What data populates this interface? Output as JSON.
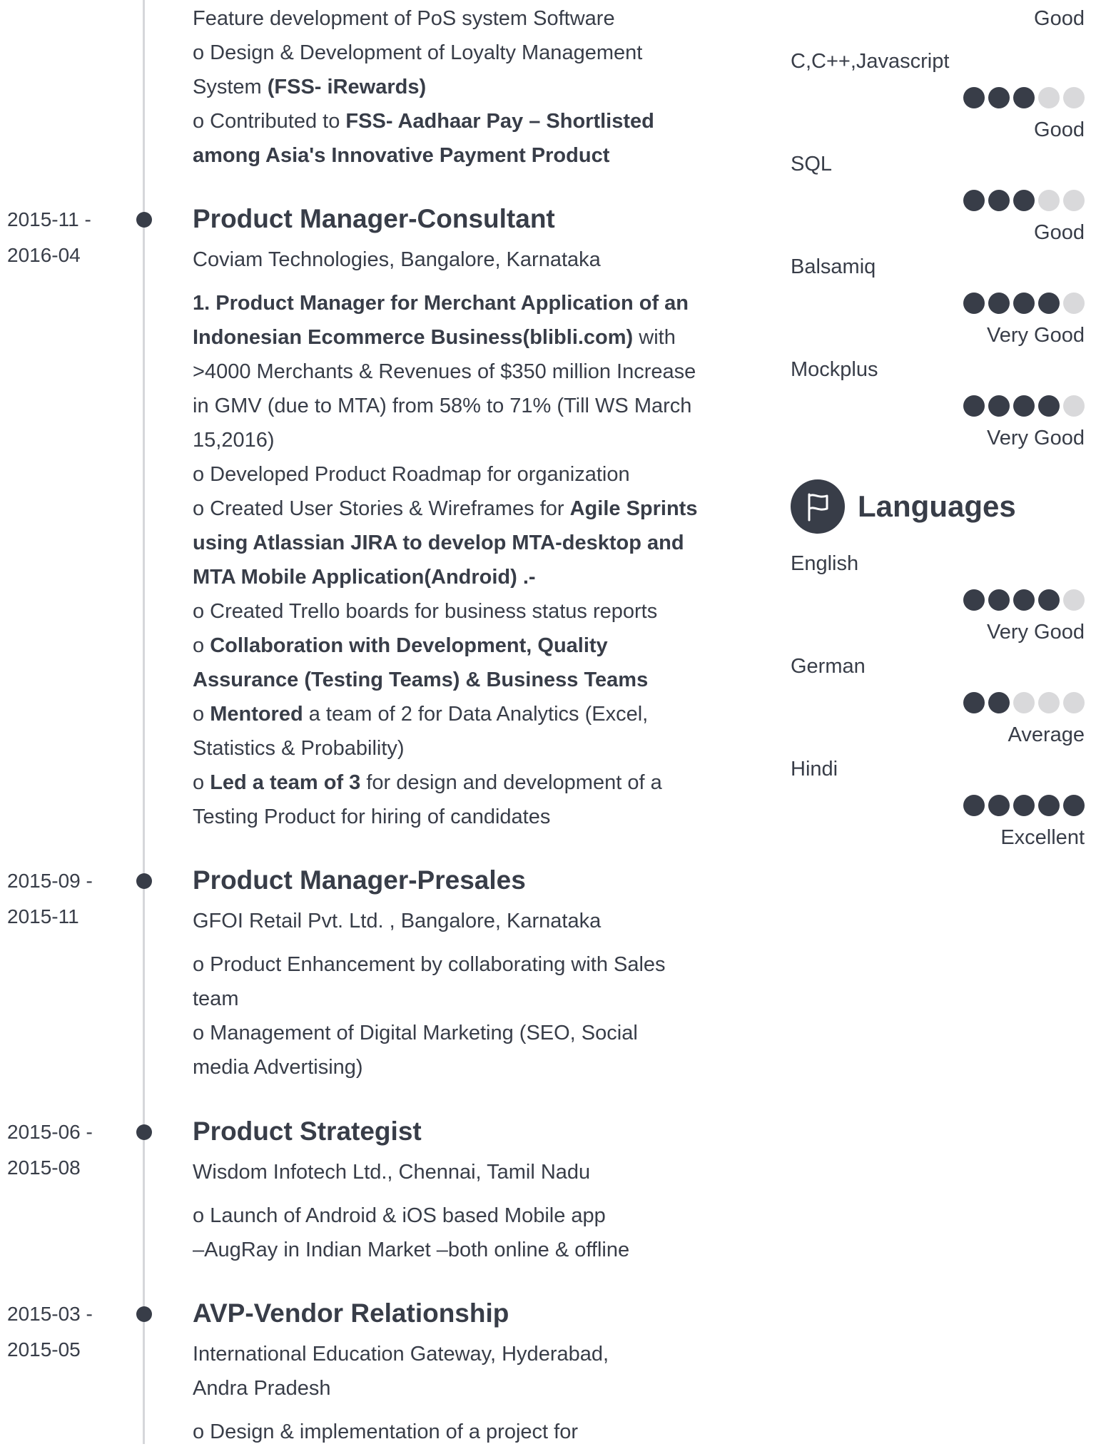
{
  "colors": {
    "text": "#383d48",
    "dot_filled": "#383d48",
    "dot_empty": "#d9d9db",
    "timeline": "#d6d7da"
  },
  "experience": {
    "intro": {
      "line1": "Feature development of PoS system Software",
      "line2": "o Design & Development of Loyalty Management",
      "line3_a": "System ",
      "line3_b": "(FSS- iRewards)",
      "line4_a": "o Contributed to ",
      "line4_b": "FSS- Aadhaar Pay – Shortlisted",
      "line5_b": "among Asia's Innovative Payment Product"
    },
    "entries": [
      {
        "date_start": "2015-11 -",
        "date_end": "2016-04",
        "title": "Product Manager-Consultant",
        "company": "Coviam Technologies, Bangalore, Karnataka",
        "d1_b": "1. Product Manager for Merchant Application of an",
        "d2_b": "Indonesian Ecommerce Business(blibli.com)",
        "d2_a": " with",
        "d3": ">4000 Merchants & Revenues of $350 million Increase",
        "d4": "in GMV (due to MTA) from 58% to 71% (Till WS March",
        "d5": "15,2016)",
        "d6": "o Developed Product Roadmap for organization",
        "d7_a": "o Created User Stories & Wireframes for ",
        "d7_b": "Agile Sprints",
        "d8_b": "using Atlassian JIRA to develop MTA-desktop and",
        "d9_b": "MTA Mobile Application(Android) .-",
        "d10": "o Created Trello boards for business status reports",
        "d11_a": "o ",
        "d11_b": "Collaboration with Development, Quality",
        "d12_b": "Assurance (Testing Teams) & Business Teams",
        "d13_a": "o ",
        "d13_b": "Mentored",
        "d13_c": " a team of 2 for Data Analytics (Excel,",
        "d14": "Statistics & Probability)",
        "d15_a": "o ",
        "d15_b": "Led a team of 3",
        "d15_c": " for design and development of a",
        "d16": "Testing Product for hiring of candidates"
      },
      {
        "date_start": "2015-09 -",
        "date_end": "2015-11",
        "title": "Product Manager-Presales",
        "company": "GFOI Retail Pvt. Ltd. , Bangalore, Karnataka",
        "d1": "o Product Enhancement by collaborating with Sales",
        "d2": "team",
        "d3": "o Management of Digital Marketing (SEO, Social",
        "d4": "media Advertising)"
      },
      {
        "date_start": "2015-06 -",
        "date_end": "2015-08",
        "title": "Product Strategist",
        "company": "Wisdom Infotech Ltd., Chennai, Tamil Nadu",
        "d1": "o Launch of Android & iOS based Mobile app",
        "d2": "–AugRay in Indian Market –both online & offline"
      },
      {
        "date_start": "2015-03 -",
        "date_end": "2015-05",
        "title": "AVP-Vendor Relationship",
        "company_l1": "International Education Gateway, Hyderabad,",
        "company_l2": "Andra Pradesh",
        "d1": "o Design & implementation of a project for"
      }
    ]
  },
  "skills": {
    "top_level": "Good",
    "items": [
      {
        "name": "C,C++,Javascript",
        "rating": 3,
        "max": 5,
        "level": "Good"
      },
      {
        "name": "SQL",
        "rating": 3,
        "max": 5,
        "level": "Good"
      },
      {
        "name": "Balsamiq",
        "rating": 4,
        "max": 5,
        "level": "Very Good"
      },
      {
        "name": "Mockplus",
        "rating": 4,
        "max": 5,
        "level": "Very Good"
      }
    ]
  },
  "languages": {
    "icon": "flag-icon",
    "title": "Languages",
    "items": [
      {
        "name": "English",
        "rating": 4,
        "max": 5,
        "level": "Very Good"
      },
      {
        "name": "German",
        "rating": 2,
        "max": 5,
        "level": "Average"
      },
      {
        "name": "Hindi",
        "rating": 5,
        "max": 5,
        "level": "Excellent"
      }
    ]
  }
}
